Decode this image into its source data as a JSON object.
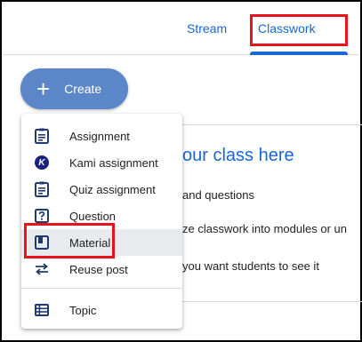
{
  "tabs": {
    "stream": "Stream",
    "classwork": "Classwork"
  },
  "create_button": {
    "plus": "+",
    "label": "Create"
  },
  "background": {
    "title": "our class here",
    "line1": "and questions",
    "line2": "ze classwork into modules or un",
    "line3": "you want students to see it"
  },
  "menu": {
    "items": [
      {
        "label": "Assignment",
        "icon": "assignment-icon"
      },
      {
        "label": "Kami assignment",
        "icon": "kami-icon"
      },
      {
        "label": "Quiz assignment",
        "icon": "quiz-icon"
      },
      {
        "label": "Question",
        "icon": "question-icon"
      },
      {
        "label": "Material",
        "icon": "material-icon"
      },
      {
        "label": "Reuse post",
        "icon": "reuse-icon"
      },
      {
        "label": "Topic",
        "icon": "topic-icon"
      }
    ],
    "kami_letter": "K"
  },
  "colors": {
    "accent": "#1967d2",
    "create_bg": "#5b87c9",
    "highlight": "#e8141b",
    "icon": "#1f3a6e"
  }
}
